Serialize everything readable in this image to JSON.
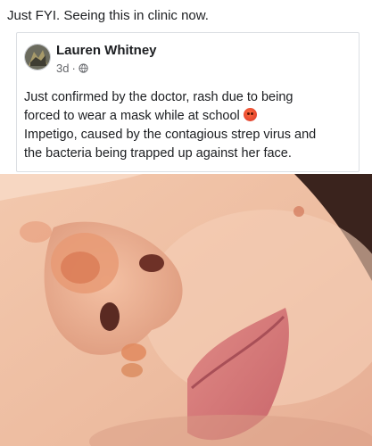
{
  "caption": "Just FYI. Seeing this in clinic now.",
  "post": {
    "author": "Lauren Whitney",
    "time": "3d",
    "separator": "·",
    "privacy_icon": "globe-icon",
    "text_lines": [
      "Just confirmed by the doctor, rash due to being",
      "forced to wear a mask while at school",
      "Impetigo, caused by the contagious strep virus and",
      "the bacteria being trapped up against her face."
    ],
    "emoji_icon": "angry-face-emoji"
  },
  "photo": {
    "subject": "close-up-face-rash-photo"
  },
  "colors": {
    "text": "#1c1e21",
    "secondary": "#65676b",
    "border": "#dcdfe3",
    "skin": "#f2c6ad",
    "rash": "#e79a74"
  }
}
